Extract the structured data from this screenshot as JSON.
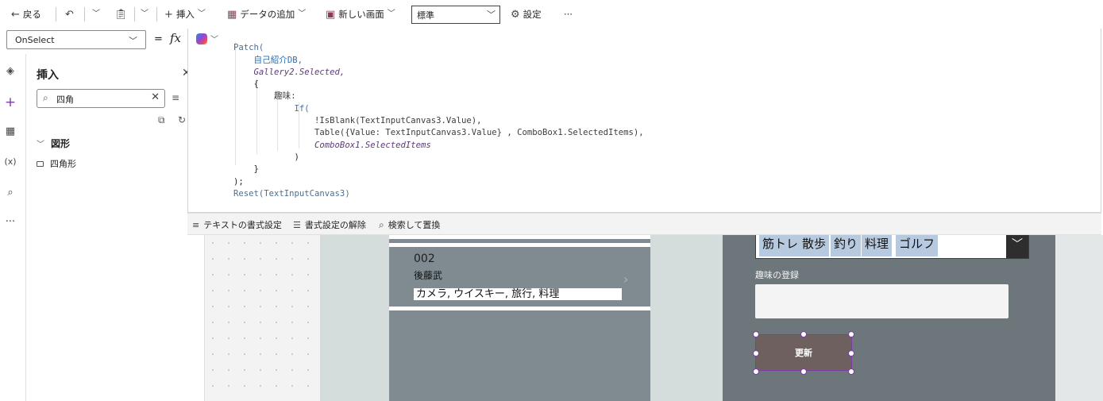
{
  "toolbar": {
    "back_label": "戻る",
    "insert_label": "挿入",
    "add_data_label": "データの追加",
    "new_screen_label": "新しい画面",
    "screen_dropdown_value": "標準",
    "settings_label": "設定",
    "more_label": "···"
  },
  "formula_bar": {
    "property_value": "OnSelect",
    "equals": "=",
    "fx": "fx"
  },
  "insert_panel": {
    "title": "挿入",
    "search_value": "四角",
    "group_label": "図形",
    "item_label": "四角形"
  },
  "rail": {
    "variables_label": "(x)",
    "more_label": "···"
  },
  "code_lines": [
    "Patch(",
    "    自己紹介DB,",
    "    Gallery2.Selected,",
    "    {",
    "        趣味:",
    "            If(",
    "                !IsBlank(TextInputCanvas3.Value),",
    "                Table({Value: TextInputCanvas3.Value} , ComboBox1.SelectedItems),",
    "                ComboBox1.SelectedItems",
    "            )",
    "    }",
    ");",
    "Reset(TextInputCanvas3)"
  ],
  "editor_footer": {
    "format_text_label": "テキストの書式設定",
    "remove_format_label": "書式設定の解除",
    "find_replace_label": "検索して置換"
  },
  "gallery": {
    "item_number": "002",
    "item_name": "後藤武",
    "item_hobbies": "カメラ, ウイスキー, 旅行, 料理"
  },
  "form": {
    "combo_tags": [
      "筋トレ",
      "散歩",
      "釣り",
      "料理",
      "ゴルフ"
    ],
    "hobby_register_label": "趣味の登録",
    "update_button_label": "更新"
  },
  "colors": {
    "gallery_bg": "#7f8b91",
    "form_bg": "#6c767b",
    "tag_bg": "#b7c9de",
    "button_bg": "#6e605f",
    "selection": "#7a3fa0"
  }
}
